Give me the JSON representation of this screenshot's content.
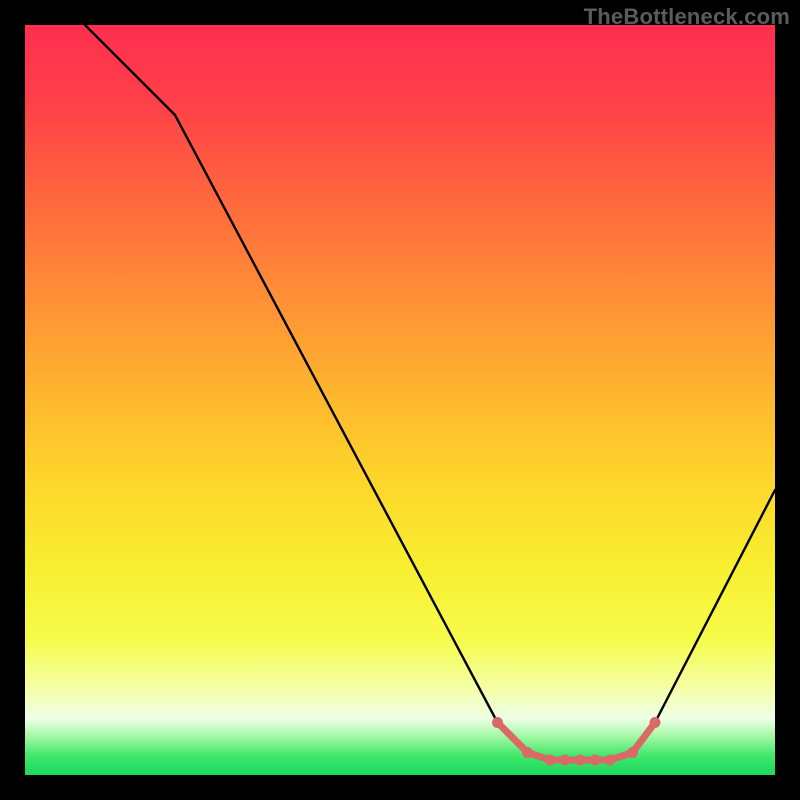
{
  "watermark": "TheBottleneck.com",
  "chart_data": {
    "type": "line",
    "title": "",
    "xlabel": "",
    "ylabel": "",
    "xlim": [
      0,
      100
    ],
    "ylim": [
      0,
      100
    ],
    "grid": false,
    "series": [
      {
        "name": "bottleneck-curve",
        "color": "#000000",
        "x": [
          8,
          20,
          63,
          67,
          70,
          72,
          74,
          76,
          78,
          81,
          84,
          100
        ],
        "y": [
          100,
          88,
          7,
          3,
          2,
          2,
          2,
          2,
          2,
          3,
          7,
          38
        ]
      },
      {
        "name": "optimal-zone-markers",
        "color": "#d96a66",
        "x": [
          63,
          67,
          70,
          72,
          74,
          76,
          78,
          81,
          84
        ],
        "y": [
          7,
          3,
          2,
          2,
          2,
          2,
          2,
          3,
          7
        ]
      }
    ],
    "gradient_stops": [
      {
        "pos": 0,
        "color": "#ff2f4f"
      },
      {
        "pos": 10,
        "color": "#ff3f49"
      },
      {
        "pos": 24,
        "color": "#ff6a3d"
      },
      {
        "pos": 36,
        "color": "#ff8e36"
      },
      {
        "pos": 48,
        "color": "#feb22f"
      },
      {
        "pos": 60,
        "color": "#fed42b"
      },
      {
        "pos": 72,
        "color": "#f8ee30"
      },
      {
        "pos": 82,
        "color": "#f6fc4a"
      },
      {
        "pos": 89,
        "color": "#f4ffb0"
      },
      {
        "pos": 92.5,
        "color": "#eeffe7"
      },
      {
        "pos": 95,
        "color": "#9df79f"
      },
      {
        "pos": 97.5,
        "color": "#3ee76a"
      },
      {
        "pos": 100,
        "color": "#1dd85f"
      }
    ]
  }
}
